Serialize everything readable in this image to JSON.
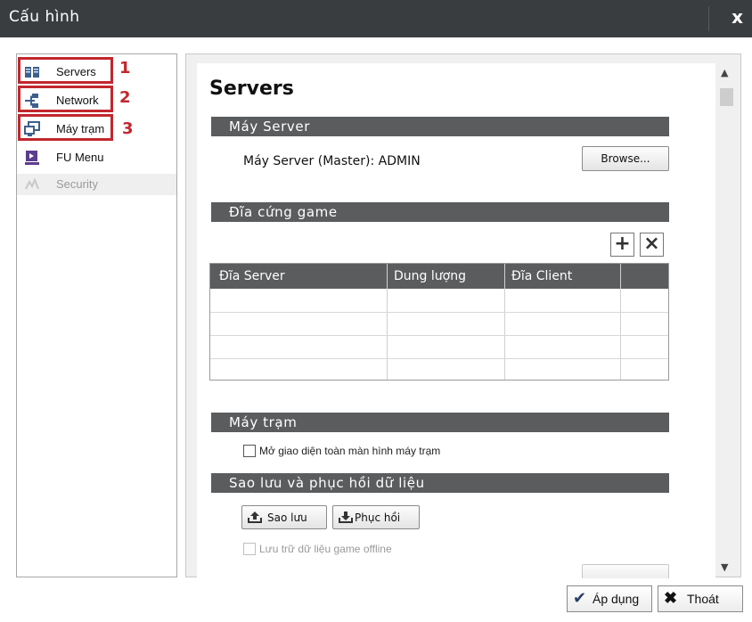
{
  "window": {
    "title": "Cấu hình",
    "close_label": "x"
  },
  "sidebar": {
    "items": [
      {
        "label": "Servers",
        "icon": "servers-icon"
      },
      {
        "label": "Network",
        "icon": "network-icon"
      },
      {
        "label": "Máy trạm",
        "icon": "workstation-icon"
      },
      {
        "label": "FU Menu",
        "icon": "fu-menu-icon"
      },
      {
        "label": "Security",
        "icon": "security-icon",
        "disabled": true
      }
    ],
    "annotations": [
      "1",
      "2",
      "3"
    ],
    "highlight_color": "#c1272d"
  },
  "main": {
    "title": "Servers",
    "server_section": {
      "header": "Máy Server",
      "server_line": "Máy Server (Master): ADMIN",
      "browse_label": "Browse..."
    },
    "disk_section": {
      "header": "Đĩa cứng game",
      "add_label": "+",
      "remove_label": "×",
      "columns": [
        "Đĩa Server",
        "Dung lượng",
        "Đĩa Client"
      ]
    },
    "workstation_section": {
      "header": "Máy trạm",
      "fullscreen_checkbox_label": "Mở giao diện toàn màn hình máy trạm"
    },
    "backup_section": {
      "header": "Sao lưu và phục hồi dữ liệu",
      "backup_label": "Sao lưu",
      "restore_label": "Phục hồi",
      "offline_checkbox_label": "Lưu trữ dữ liệu game offline"
    }
  },
  "footer": {
    "apply_label": "Áp dụng",
    "exit_label": "Thoát"
  },
  "colors": {
    "titlebar": "#3a3d40",
    "section_header": "#5a5c5e",
    "annotation": "#c1272d"
  }
}
